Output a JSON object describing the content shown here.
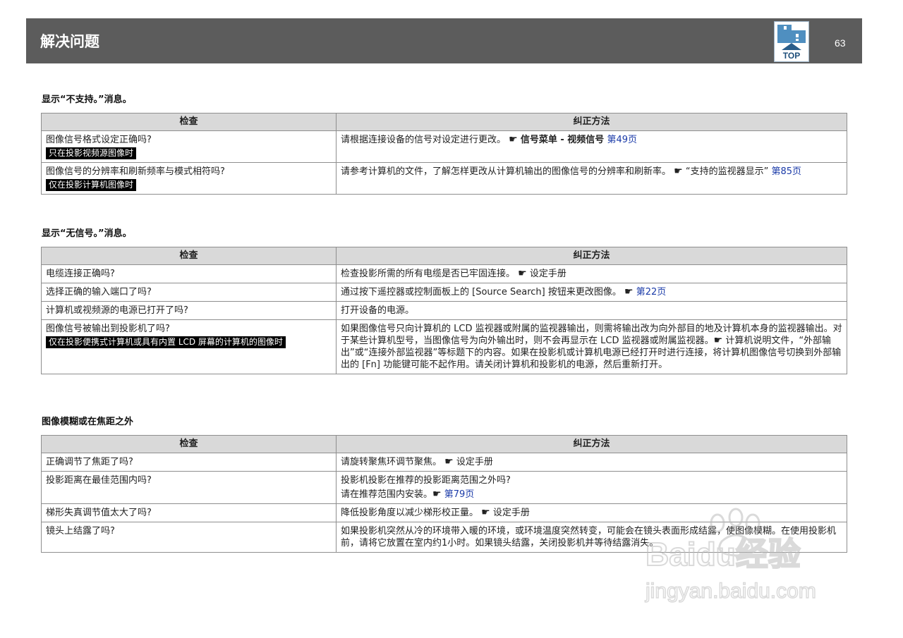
{
  "header": {
    "title": "解决问题",
    "top_label": "TOP",
    "page_number": "63"
  },
  "sections": [
    {
      "title": "显示“不支持。”消息。",
      "col_check": "检查",
      "col_fix": "纠正方法",
      "rows": [
        {
          "check": "图像信号格式设定正确吗?",
          "badge": "只在投影视频源图像时",
          "fix_text": "请根据连接设备的信号对设定进行更改。",
          "ref_text": "信号菜单 - 视频信号",
          "link": "第49页"
        },
        {
          "check": "图像信号的分辨率和刷新频率与模式相符吗?",
          "badge": "仅在投影计算机图像时",
          "fix_text": "请参考计算机的文件，了解怎样更改从计算机输出的图像信号的分辨率和刷新率。",
          "ref_text": "“支持的监视器显示”",
          "link": "第85页"
        }
      ]
    },
    {
      "title": "显示“无信号。”消息。",
      "col_check": "检查",
      "col_fix": "纠正方法",
      "rows": [
        {
          "check": "电缆连接正确吗?",
          "fix_text": "检查投影所需的所有电缆是否已牢固连接。",
          "ref_text": "设定手册"
        },
        {
          "check": "选择正确的输入端口了吗?",
          "fix_text": "通过按下遥控器或控制面板上的 [Source Search] 按钮来更改图像。",
          "link": "第22页"
        },
        {
          "check": "计算机或视频源的电源已打开了吗?",
          "fix_text": "打开设备的电源。"
        },
        {
          "check": "图像信号被输出到投影机了吗?",
          "badge": "仅在投影便携式计算机或具有内置 LCD 屏幕的计算机的图像时",
          "fix_text": "如果图像信号只向计算机的 LCD 监视器或附属的监视器输出，则需将输出改为向外部目的地及计算机本身的监视器输出。对于某些计算机型号，当图像信号为向外输出时，则不会再显示在 LCD 监视器或附属监视器。",
          "fix_text2": "计算机说明文件，“外部输出”或“连接外部监视器”等标题下的内容。如果在投影机或计算机电源已经打开时进行连接，将计算机图像信号切换到外部输出的 [Fn] 功能键可能不起作用。请关闭计算机和投影机的电源，然后重新打开。"
        }
      ]
    },
    {
      "title": "图像模糊或在焦距之外",
      "col_check": "检查",
      "col_fix": "纠正方法",
      "rows": [
        {
          "check": "正确调节了焦距了吗?",
          "fix_text": "请旋转聚焦环调节聚焦。",
          "ref_text": "设定手册"
        },
        {
          "check": "投影距离在最佳范围内吗?",
          "fix_text": "投影机投影在推荐的投影距离范围之外吗?",
          "fix_text2": "请在推荐范围内安装。",
          "link": "第79页"
        },
        {
          "check": "梯形失真调节值太大了吗?",
          "fix_text": "降低投影角度以减少梯形校正量。",
          "ref_text": "设定手册"
        },
        {
          "check": "镜头上结露了吗?",
          "fix_text": "如果投影机突然从冷的环境带入暖的环境，或环境温度突然转变，可能会在镜头表面形成结露，使图像模糊。在使用投影机前，请将它放置在室内约1小时。如果镜头结露，关闭投影机并等待结露消失。"
        }
      ]
    }
  ],
  "watermark": {
    "brand": "Baidu经验",
    "url": "jingyan.baidu.com"
  }
}
